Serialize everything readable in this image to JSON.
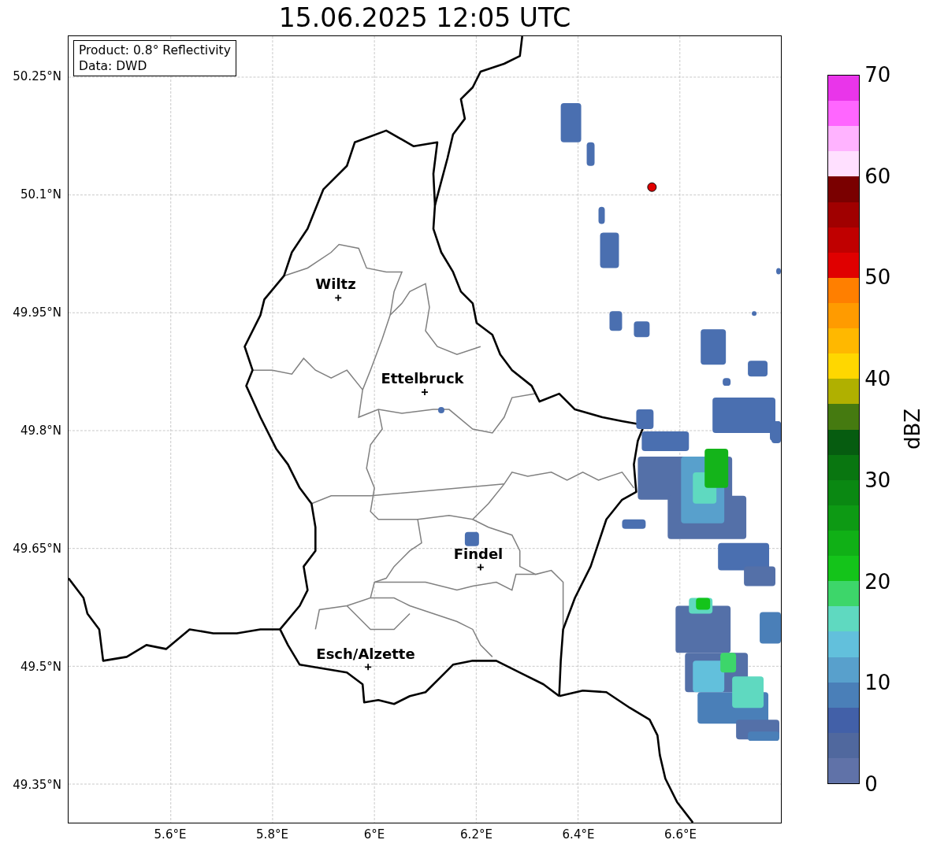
{
  "title": "15.06.2025 12:05 UTC",
  "info_box": [
    "Product: 0.8° Reflectivity",
    "Data: DWD"
  ],
  "map": {
    "y_ticks": [
      "50.25°N",
      "50.1°N",
      "49.95°N",
      "49.8°N",
      "49.65°N",
      "49.5°N",
      "49.35°N"
    ],
    "x_ticks": [
      "5.6°E",
      "5.8°E",
      "6°E",
      "6.2°E",
      "6.4°E",
      "6.6°E"
    ],
    "cities": [
      {
        "name": "Wiltz"
      },
      {
        "name": "Ettelbruck"
      },
      {
        "name": "Findel"
      },
      {
        "name": "Esch/Alzette"
      }
    ]
  },
  "colorbar": {
    "label": "dBZ",
    "ticks": [
      "70",
      "60",
      "50",
      "40",
      "30",
      "20",
      "10",
      "0"
    ],
    "segments": [
      {
        "color": "#e935ea"
      },
      {
        "color": "#ff66ff"
      },
      {
        "color": "#ffb3ff"
      },
      {
        "color": "#ffe0ff"
      },
      {
        "color": "#7a0000"
      },
      {
        "color": "#a00000"
      },
      {
        "color": "#c00000"
      },
      {
        "color": "#e00000"
      },
      {
        "color": "#ff7f00"
      },
      {
        "color": "#ff9b00"
      },
      {
        "color": "#ffb800"
      },
      {
        "color": "#ffd700"
      },
      {
        "color": "#b0b000"
      },
      {
        "color": "#457a10"
      },
      {
        "color": "#065c10"
      },
      {
        "color": "#097610"
      },
      {
        "color": "#0a8812"
      },
      {
        "color": "#0d9a14"
      },
      {
        "color": "#10b016"
      },
      {
        "color": "#14c41a"
      },
      {
        "color": "#3dd66a"
      },
      {
        "color": "#5fd9c0"
      },
      {
        "color": "#62c0dc"
      },
      {
        "color": "#58a0cc"
      },
      {
        "color": "#4a7fb8"
      },
      {
        "color": "#4260a8"
      },
      {
        "color": "#50689e"
      },
      {
        "color": "#6072a8"
      }
    ]
  }
}
